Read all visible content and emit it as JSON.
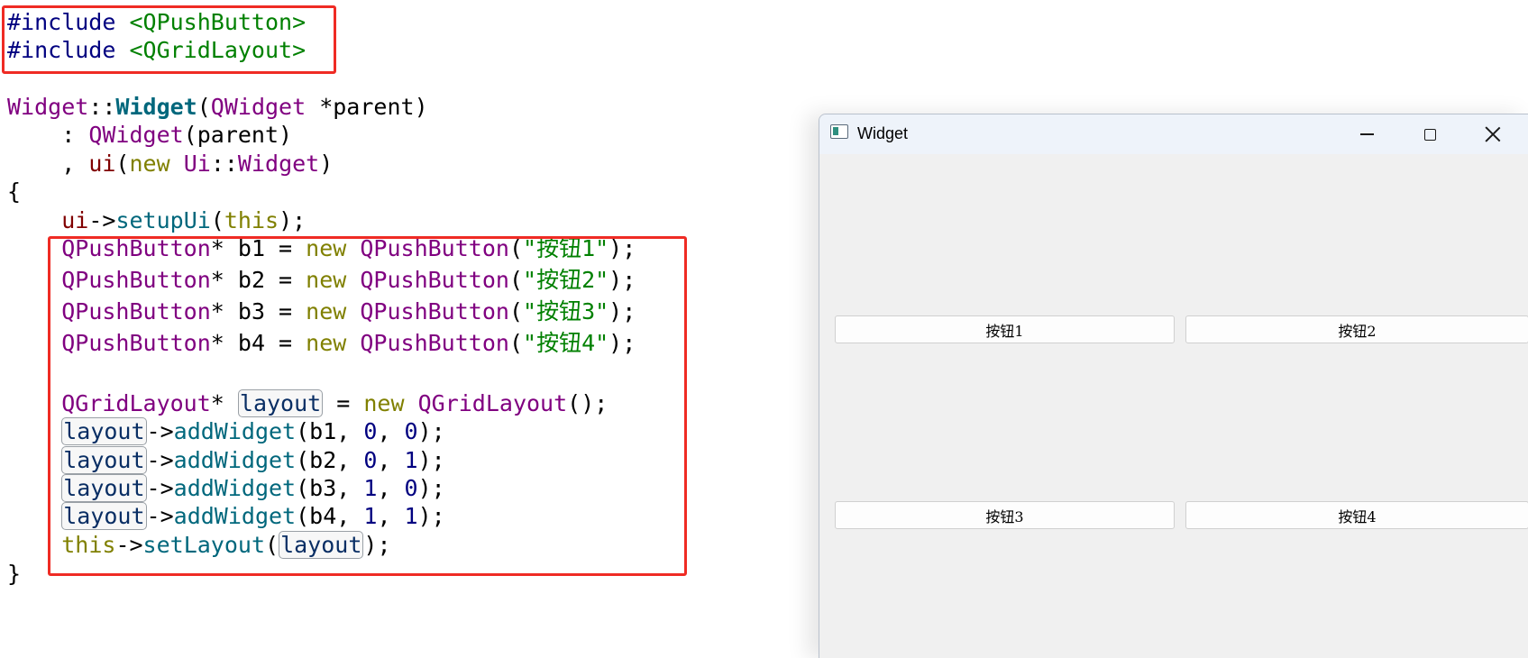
{
  "code": {
    "lines": [
      [
        {
          "t": "#include ",
          "c": "pre"
        },
        {
          "t": "<QPushButton>",
          "c": "inc"
        }
      ],
      [
        {
          "t": "#include ",
          "c": "pre"
        },
        {
          "t": "<QGridLayout>",
          "c": "inc"
        }
      ],
      [],
      [
        {
          "t": "Widget",
          "c": "type"
        },
        {
          "t": "::",
          "c": "punc"
        },
        {
          "t": "Widget",
          "c": "bold"
        },
        {
          "t": "(",
          "c": "punc"
        },
        {
          "t": "QWidget",
          "c": "type"
        },
        {
          "t": " *parent)",
          "c": "punc"
        }
      ],
      [
        {
          "t": "    : ",
          "c": "punc"
        },
        {
          "t": "QWidget",
          "c": "type"
        },
        {
          "t": "(parent)",
          "c": "punc"
        }
      ],
      [
        {
          "t": "    , ",
          "c": "punc"
        },
        {
          "t": "ui",
          "c": "field"
        },
        {
          "t": "(",
          "c": "punc"
        },
        {
          "t": "new",
          "c": "kw"
        },
        {
          "t": " ",
          "c": "punc"
        },
        {
          "t": "Ui",
          "c": "type"
        },
        {
          "t": "::",
          "c": "punc"
        },
        {
          "t": "Widget",
          "c": "type"
        },
        {
          "t": ")",
          "c": "punc"
        }
      ],
      [
        {
          "t": "{",
          "c": "punc"
        }
      ],
      [
        {
          "t": "    ",
          "c": "punc"
        },
        {
          "t": "ui",
          "c": "field"
        },
        {
          "t": "->",
          "c": "punc"
        },
        {
          "t": "setupUi",
          "c": "func"
        },
        {
          "t": "(",
          "c": "punc"
        },
        {
          "t": "this",
          "c": "kw"
        },
        {
          "t": ");",
          "c": "punc"
        }
      ],
      [
        {
          "t": "    ",
          "c": "punc"
        },
        {
          "t": "QPushButton",
          "c": "type"
        },
        {
          "t": "* b1 = ",
          "c": "punc"
        },
        {
          "t": "new",
          "c": "kw"
        },
        {
          "t": " ",
          "c": "punc"
        },
        {
          "t": "QPushButton",
          "c": "type"
        },
        {
          "t": "(",
          "c": "punc"
        },
        {
          "t": "\"按钮1\"",
          "c": "str"
        },
        {
          "t": ");",
          "c": "punc"
        }
      ],
      [
        {
          "t": "    ",
          "c": "punc"
        },
        {
          "t": "QPushButton",
          "c": "type"
        },
        {
          "t": "* b2 = ",
          "c": "punc"
        },
        {
          "t": "new",
          "c": "kw"
        },
        {
          "t": " ",
          "c": "punc"
        },
        {
          "t": "QPushButton",
          "c": "type"
        },
        {
          "t": "(",
          "c": "punc"
        },
        {
          "t": "\"按钮2\"",
          "c": "str"
        },
        {
          "t": ");",
          "c": "punc"
        }
      ],
      [
        {
          "t": "    ",
          "c": "punc"
        },
        {
          "t": "QPushButton",
          "c": "type"
        },
        {
          "t": "* b3 = ",
          "c": "punc"
        },
        {
          "t": "new",
          "c": "kw"
        },
        {
          "t": " ",
          "c": "punc"
        },
        {
          "t": "QPushButton",
          "c": "type"
        },
        {
          "t": "(",
          "c": "punc"
        },
        {
          "t": "\"按钮3\"",
          "c": "str"
        },
        {
          "t": ");",
          "c": "punc"
        }
      ],
      [
        {
          "t": "    ",
          "c": "punc"
        },
        {
          "t": "QPushButton",
          "c": "type"
        },
        {
          "t": "* b4 = ",
          "c": "punc"
        },
        {
          "t": "new",
          "c": "kw"
        },
        {
          "t": " ",
          "c": "punc"
        },
        {
          "t": "QPushButton",
          "c": "type"
        },
        {
          "t": "(",
          "c": "punc"
        },
        {
          "t": "\"按钮4\"",
          "c": "str"
        },
        {
          "t": ");",
          "c": "punc"
        }
      ],
      [],
      [
        {
          "t": "    ",
          "c": "punc"
        },
        {
          "t": "QGridLayout",
          "c": "type"
        },
        {
          "t": "* ",
          "c": "punc"
        },
        {
          "t": "layout",
          "c": "hl"
        },
        {
          "t": " = ",
          "c": "punc"
        },
        {
          "t": "new",
          "c": "kw"
        },
        {
          "t": " ",
          "c": "punc"
        },
        {
          "t": "QGridLayout",
          "c": "type"
        },
        {
          "t": "();",
          "c": "punc"
        }
      ],
      [
        {
          "t": "    ",
          "c": "punc"
        },
        {
          "t": "layout",
          "c": "hl"
        },
        {
          "t": "->",
          "c": "punc"
        },
        {
          "t": "addWidget",
          "c": "func"
        },
        {
          "t": "(b1, ",
          "c": "punc"
        },
        {
          "t": "0",
          "c": "num"
        },
        {
          "t": ", ",
          "c": "punc"
        },
        {
          "t": "0",
          "c": "num"
        },
        {
          "t": ");",
          "c": "punc"
        }
      ],
      [
        {
          "t": "    ",
          "c": "punc"
        },
        {
          "t": "layout",
          "c": "hl"
        },
        {
          "t": "->",
          "c": "punc"
        },
        {
          "t": "addWidget",
          "c": "func"
        },
        {
          "t": "(b2, ",
          "c": "punc"
        },
        {
          "t": "0",
          "c": "num"
        },
        {
          "t": ", ",
          "c": "punc"
        },
        {
          "t": "1",
          "c": "num"
        },
        {
          "t": ");",
          "c": "punc"
        }
      ],
      [
        {
          "t": "    ",
          "c": "punc"
        },
        {
          "t": "layout",
          "c": "hl"
        },
        {
          "t": "->",
          "c": "punc"
        },
        {
          "t": "addWidget",
          "c": "func"
        },
        {
          "t": "(b3, ",
          "c": "punc"
        },
        {
          "t": "1",
          "c": "num"
        },
        {
          "t": ", ",
          "c": "punc"
        },
        {
          "t": "0",
          "c": "num"
        },
        {
          "t": ");",
          "c": "punc"
        }
      ],
      [
        {
          "t": "    ",
          "c": "punc"
        },
        {
          "t": "layout",
          "c": "hl"
        },
        {
          "t": "->",
          "c": "punc"
        },
        {
          "t": "addWidget",
          "c": "func"
        },
        {
          "t": "(b4, ",
          "c": "punc"
        },
        {
          "t": "1",
          "c": "num"
        },
        {
          "t": ", ",
          "c": "punc"
        },
        {
          "t": "1",
          "c": "num"
        },
        {
          "t": ");",
          "c": "punc"
        }
      ],
      [
        {
          "t": "    ",
          "c": "punc"
        },
        {
          "t": "this",
          "c": "kw"
        },
        {
          "t": "->",
          "c": "punc"
        },
        {
          "t": "setLayout",
          "c": "func"
        },
        {
          "t": "(",
          "c": "punc"
        },
        {
          "t": "layout",
          "c": "hl"
        },
        {
          "t": ");",
          "c": "punc"
        }
      ],
      [
        {
          "t": "}",
          "c": "punc"
        }
      ]
    ]
  },
  "window": {
    "title": "Widget",
    "buttons": [
      {
        "label": "按钮1"
      },
      {
        "label": "按钮2"
      },
      {
        "label": "按钮3"
      },
      {
        "label": "按钮4"
      }
    ]
  },
  "colors": {
    "highlight_box": "#ef2b24",
    "preprocessor": "#000080",
    "include_path": "#008000",
    "type": "#800080",
    "function": "#00677c",
    "keyword": "#808000",
    "string": "#008000",
    "number": "#000080",
    "member": "#800000"
  },
  "icons": {
    "app": "app-window-icon",
    "minimize": "minimize-icon",
    "maximize": "maximize-icon",
    "close": "close-icon"
  }
}
